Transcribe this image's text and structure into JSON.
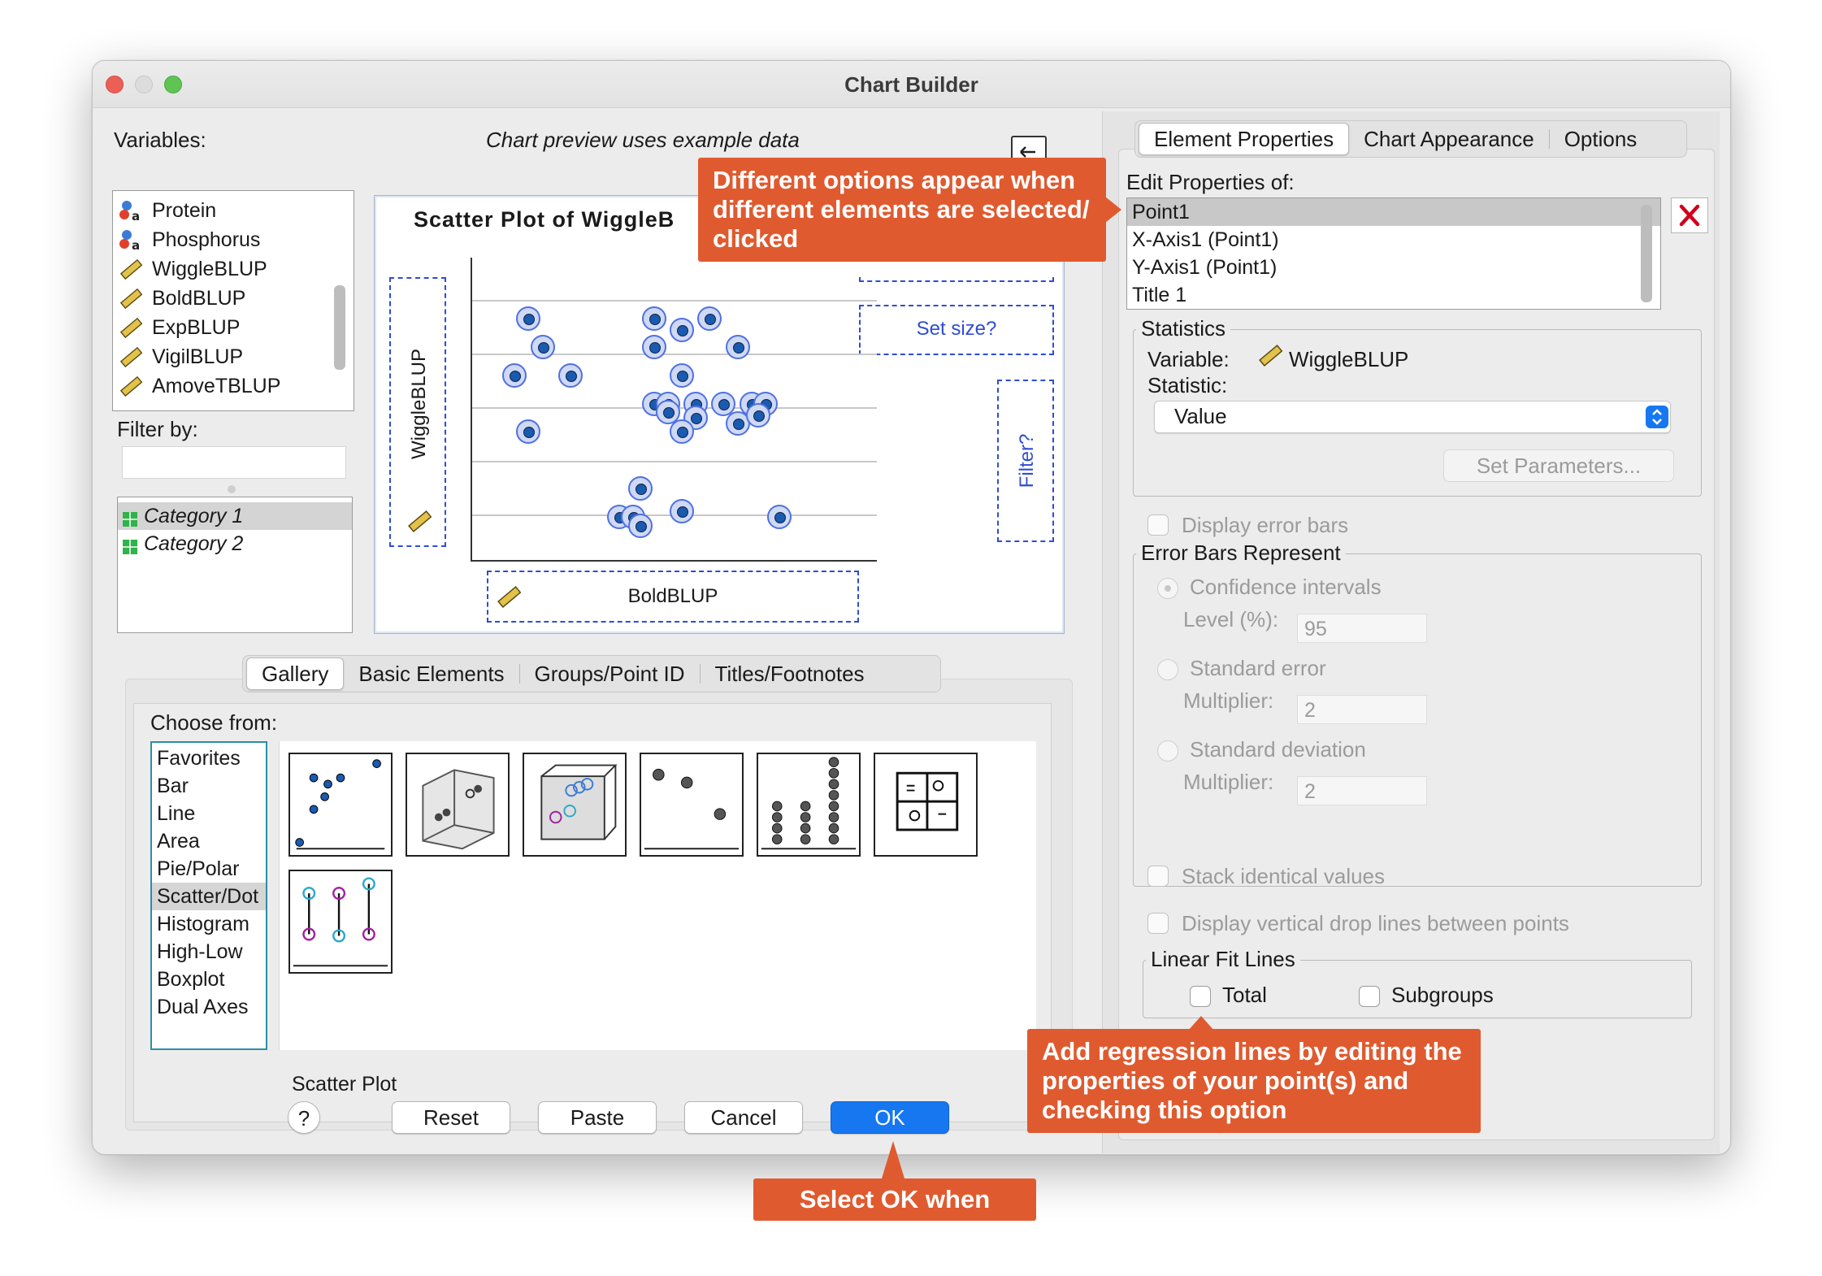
{
  "window": {
    "title": "Chart Builder"
  },
  "left": {
    "variables_label": "Variables:",
    "preview_note": "Chart preview uses example data",
    "variables": [
      {
        "name": "Protein",
        "type": "nominal"
      },
      {
        "name": "Phosphorus",
        "type": "nominal"
      },
      {
        "name": "WiggleBLUP",
        "type": "scale"
      },
      {
        "name": "BoldBLUP",
        "type": "scale"
      },
      {
        "name": "ExpBLUP",
        "type": "scale"
      },
      {
        "name": "VigilBLUP",
        "type": "scale"
      },
      {
        "name": "AmoveTBLUP",
        "type": "scale"
      }
    ],
    "filter_label": "Filter by:",
    "categories": [
      "Category 1",
      "Category 2"
    ]
  },
  "preview": {
    "chart_title": "Scatter Plot of WiggleB",
    "y_zone_label": "WiggleBLUP",
    "x_zone_label": "BoldBLUP",
    "set_size_label": "Set size?",
    "filter_zone_label": "Filter?",
    "chart_data": {
      "type": "scatter",
      "title": "Scatter Plot of WiggleB",
      "xlabel": "BoldBLUP",
      "ylabel": "WiggleBLUP",
      "grid": true,
      "points": [
        [
          3,
          8
        ],
        [
          4,
          7
        ],
        [
          2,
          6
        ],
        [
          6,
          6
        ],
        [
          3,
          4
        ],
        [
          12,
          8
        ],
        [
          14,
          7.6
        ],
        [
          16,
          8
        ],
        [
          12,
          7
        ],
        [
          18,
          7
        ],
        [
          14,
          6
        ],
        [
          12,
          5
        ],
        [
          13,
          5
        ],
        [
          13,
          4.7
        ],
        [
          15,
          5
        ],
        [
          17,
          5
        ],
        [
          19,
          5
        ],
        [
          20,
          5
        ],
        [
          15,
          4.5
        ],
        [
          18,
          4.3
        ],
        [
          19.5,
          4.6
        ],
        [
          14,
          4
        ],
        [
          11,
          2
        ],
        [
          9.5,
          1
        ],
        [
          10.5,
          1
        ],
        [
          14,
          1.2
        ],
        [
          11,
          0.7
        ],
        [
          21,
          1
        ]
      ]
    }
  },
  "tabs_lower": [
    "Gallery",
    "Basic Elements",
    "Groups/Point ID",
    "Titles/Footnotes"
  ],
  "gallery": {
    "choose_label": "Choose from:",
    "items": [
      "Favorites",
      "Bar",
      "Line",
      "Area",
      "Pie/Polar",
      "Scatter/Dot",
      "Histogram",
      "High-Low",
      "Boxplot",
      "Dual Axes"
    ],
    "selected": "Scatter/Dot",
    "hovered_type": "Scatter Plot",
    "thumbnails": [
      "simple-scatter",
      "3d-scatter",
      "grouped-3d-scatter",
      "summary-point",
      "simple-dot",
      "scatterplot-matrix",
      "drop-line"
    ]
  },
  "buttons": {
    "help": "?",
    "reset": "Reset",
    "paste": "Paste",
    "cancel": "Cancel",
    "ok": "OK"
  },
  "right": {
    "tabs": [
      "Element Properties",
      "Chart Appearance",
      "Options"
    ],
    "edit_props_label": "Edit Properties of:",
    "properties_list": [
      "Point1",
      "X-Axis1 (Point1)",
      "Y-Axis1 (Point1)",
      "Title 1"
    ],
    "statistics": {
      "title": "Statistics",
      "variable_label": "Variable:",
      "variable_value": "WiggleBLUP",
      "statistic_label": "Statistic:",
      "statistic_value": "Value",
      "set_parameters": "Set Parameters..."
    },
    "display_error_bars": "Display error bars",
    "error_bars": {
      "title": "Error Bars Represent",
      "ci_label": "Confidence intervals",
      "level_label": "Level (%):",
      "level_value": "95",
      "se_label": "Standard error",
      "se_mult_label": "Multiplier:",
      "se_mult_value": "2",
      "sd_label": "Standard deviation",
      "sd_mult_label": "Multiplier:",
      "sd_mult_value": "2"
    },
    "stack_identical": "Stack identical values",
    "drop_lines": "Display vertical drop lines between points",
    "linear_fit": {
      "title": "Linear Fit Lines",
      "total": "Total",
      "subgroups": "Subgroups"
    }
  },
  "callouts": {
    "top": "Different options appear when different elements are selected/ clicked",
    "bottom_right": "Add regression lines by editing the properties of your point(s) and checking this option",
    "ok": "Select OK when done"
  },
  "colors": {
    "callout": "#e05a2f",
    "ok_button": "#1677f1",
    "drop_zone": "#2f4cd4",
    "delete_x": "#d0021b"
  }
}
